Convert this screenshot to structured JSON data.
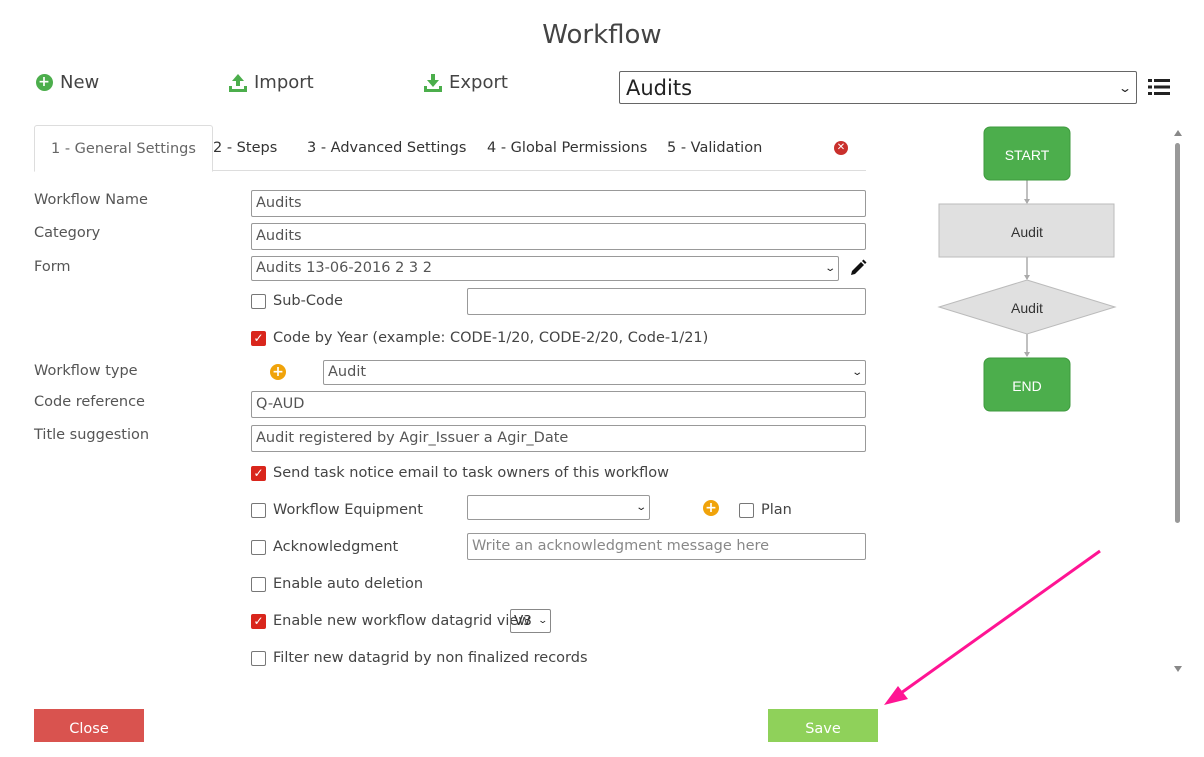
{
  "title": "Workflow",
  "toolbar": {
    "new_label": "New",
    "import_label": "Import",
    "export_label": "Export"
  },
  "workflow_select": {
    "value": "Audits"
  },
  "tabs": [
    {
      "label": "1 - General Settings",
      "active": true
    },
    {
      "label": "2 - Steps"
    },
    {
      "label": "3 - Advanced Settings"
    },
    {
      "label": "4 - Global Permissions"
    },
    {
      "label": "5 - Validation"
    }
  ],
  "form": {
    "workflow_name": {
      "label": "Workflow Name",
      "value": "Audits"
    },
    "category": {
      "label": "Category",
      "value": "Audits"
    },
    "form": {
      "label": "Form",
      "value": "Audits 13-06-2016 2 3 2"
    },
    "sub_code": {
      "label": "Sub-Code",
      "checked": false,
      "value": ""
    },
    "code_by_year": {
      "label": "Code by Year (example: CODE-1/20, CODE-2/20, Code-1/21)",
      "checked": true
    },
    "workflow_type": {
      "label": "Workflow type",
      "value": "Audit"
    },
    "code_reference": {
      "label": "Code reference",
      "value": "Q-AUD"
    },
    "title_suggestion": {
      "label": "Title suggestion",
      "value": "Audit registered by Agir_Issuer a Agir_Date"
    },
    "send_notice": {
      "label": "Send task notice email to task owners of this workflow",
      "checked": true
    },
    "workflow_equipment": {
      "label": "Workflow Equipment",
      "checked": false,
      "value": ""
    },
    "plan": {
      "label": "Plan",
      "checked": false
    },
    "acknowledgment": {
      "label": "Acknowledgment",
      "checked": false,
      "placeholder": "Write an acknowledgment message here"
    },
    "auto_deletion": {
      "label": "Enable auto deletion",
      "checked": false
    },
    "datagrid_view": {
      "label": "Enable new workflow datagrid view",
      "checked": true,
      "version": "V3"
    },
    "filter_datagrid": {
      "label": "Filter new datagrid by non finalized records",
      "checked": false
    }
  },
  "flow": {
    "start": "START",
    "step": "Audit",
    "decision": "Audit",
    "end": "END"
  },
  "buttons": {
    "close": "Close",
    "save": "Save"
  },
  "colors": {
    "green": "#4cae4c",
    "gray_box": "#e0e0e0",
    "close_btn": "#d9534f",
    "save_btn": "#8fd15a",
    "checkbox": "#d9261c",
    "arrow": "#ff1493"
  },
  "icons": [
    "plus-circle-icon",
    "upload-icon",
    "download-icon",
    "list-icon",
    "close-circle-icon",
    "pencil-icon",
    "chevron-down-icon"
  ]
}
